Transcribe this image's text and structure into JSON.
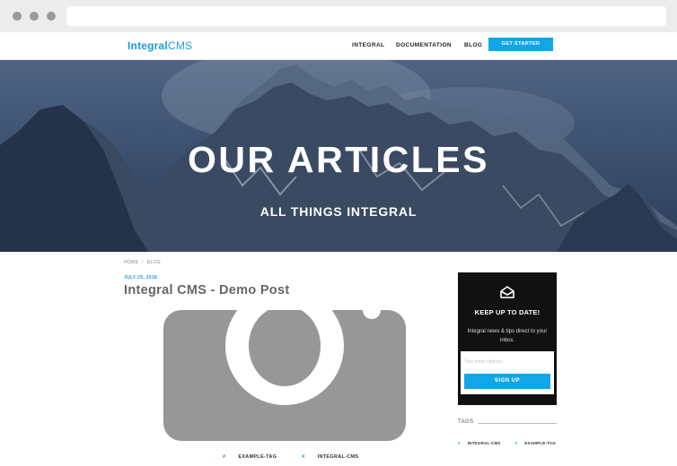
{
  "site": {
    "brand_bold": "Integral",
    "brand_light": "CMS",
    "nav": [
      "INTEGRAL",
      "DOCUMENTATION",
      "BLOG"
    ],
    "cta_label": "GET STARTED"
  },
  "hero": {
    "title": "OUR ARTICLES",
    "subtitle": "ALL THINGS INTEGRAL"
  },
  "breadcrumb": [
    "HOME",
    "BLOG"
  ],
  "post": {
    "date": "JULY 25, 2018",
    "title": "Integral CMS - Demo Post",
    "tags": [
      "EXAMPLE-TAG",
      "INTEGRAL-CMS"
    ]
  },
  "newsletter": {
    "title": "KEEP UP TO DATE!",
    "text": "Integral news & tips direct to your inbox.",
    "email_placeholder": "Your email address...",
    "button_label": "SIGN UP"
  },
  "sidebar_tags": {
    "heading": "TAGS",
    "items": [
      "INTEGRAL-CMS",
      "EXAMPLE-TAG"
    ]
  },
  "colors": {
    "accent": "#12a6e8",
    "brand": "#1e9ad6",
    "newsletter_bg": "#111111"
  }
}
